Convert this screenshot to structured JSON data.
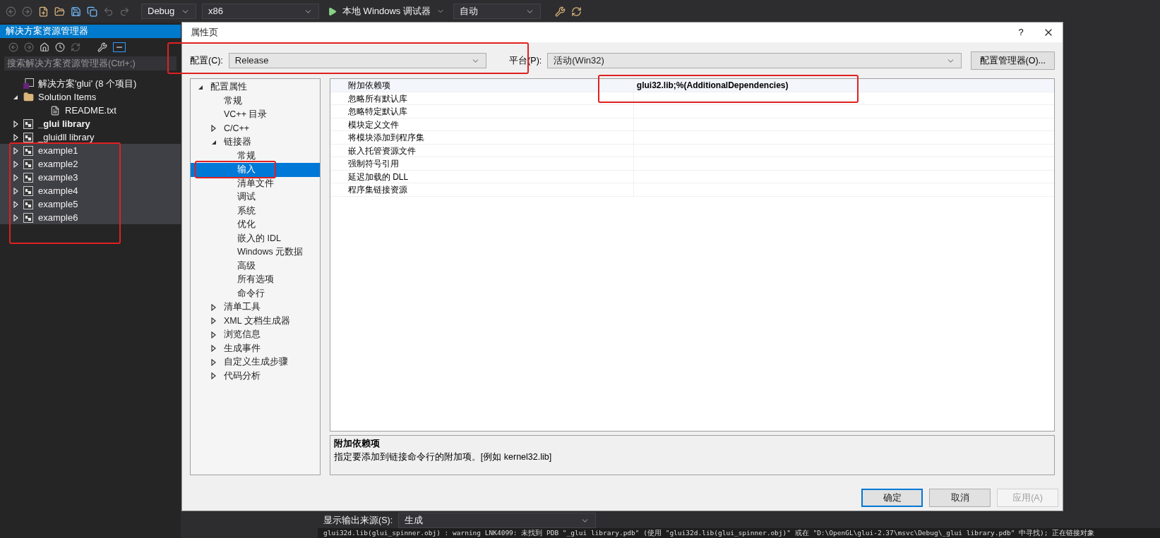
{
  "toolbar": {
    "configuration": "Debug",
    "platform": "x86",
    "debugger": "本地 Windows 调试器",
    "target": "自动"
  },
  "solution_explorer": {
    "title": "解决方案资源管理器",
    "search": {
      "placeholder": "搜索解决方案资源管理器(Ctrl+;)"
    },
    "items": [
      {
        "label": "解决方案'glui' (8 个项目)",
        "kind": "solution",
        "selected": false,
        "startup": false
      },
      {
        "label": "Solution Items",
        "kind": "folder",
        "expanded": true,
        "selected": false,
        "startup": false,
        "children": [
          {
            "label": "README.txt",
            "kind": "file",
            "selected": false,
            "startup": false
          }
        ]
      },
      {
        "label": "_glui library",
        "kind": "project",
        "expanded": false,
        "selected": false,
        "startup": true
      },
      {
        "label": "_gluidll library",
        "kind": "project",
        "expanded": false,
        "selected": false,
        "startup": false
      },
      {
        "label": "example1",
        "kind": "project",
        "expanded": false,
        "selected": true,
        "startup": false
      },
      {
        "label": "example2",
        "kind": "project",
        "expanded": false,
        "selected": true,
        "startup": false
      },
      {
        "label": "example3",
        "kind": "project",
        "expanded": false,
        "selected": true,
        "startup": false
      },
      {
        "label": "example4",
        "kind": "project",
        "expanded": false,
        "selected": true,
        "startup": false
      },
      {
        "label": "example5",
        "kind": "project",
        "expanded": false,
        "selected": true,
        "startup": false
      },
      {
        "label": "example6",
        "kind": "project",
        "expanded": false,
        "selected": true,
        "startup": false
      }
    ]
  },
  "dialog": {
    "title": "属性页",
    "help": "?",
    "config_label": "配置(C):",
    "config": "Release",
    "platform_label": "平台(P):",
    "platform": "活动(Win32)",
    "manager_button": "配置管理器(O)...",
    "tree": [
      {
        "label": "配置属性",
        "expanded": true,
        "selected": false,
        "children": [
          {
            "label": "常规",
            "selected": false
          },
          {
            "label": "VC++ 目录",
            "selected": false
          },
          {
            "label": "C/C++",
            "expanded": false,
            "selected": false
          },
          {
            "label": "链接器",
            "expanded": true,
            "selected": false,
            "children": [
              {
                "label": "常规",
                "selected": false
              },
              {
                "label": "输入",
                "selected": true
              },
              {
                "label": "清单文件",
                "selected": false
              },
              {
                "label": "调试",
                "selected": false
              },
              {
                "label": "系统",
                "selected": false
              },
              {
                "label": "优化",
                "selected": false
              },
              {
                "label": "嵌入的 IDL",
                "selected": false
              },
              {
                "label": "Windows 元数据",
                "selected": false
              },
              {
                "label": "高级",
                "selected": false
              },
              {
                "label": "所有选项",
                "selected": false
              },
              {
                "label": "命令行",
                "selected": false
              }
            ]
          },
          {
            "label": "清单工具",
            "expanded": false,
            "selected": false
          },
          {
            "label": "XML 文档生成器",
            "expanded": false,
            "selected": false
          },
          {
            "label": "浏览信息",
            "expanded": false,
            "selected": false
          },
          {
            "label": "生成事件",
            "expanded": false,
            "selected": false
          },
          {
            "label": "自定义生成步骤",
            "expanded": false,
            "selected": false
          },
          {
            "label": "代码分析",
            "expanded": false,
            "selected": false
          }
        ]
      }
    ],
    "properties": [
      {
        "name": "附加依赖项",
        "value": "glui32.lib;%(AdditionalDependencies)",
        "selected": true
      },
      {
        "name": "忽略所有默认库",
        "selected": false
      },
      {
        "name": "忽略特定默认库",
        "selected": false
      },
      {
        "name": "模块定义文件",
        "selected": false
      },
      {
        "name": "将模块添加到程序集",
        "selected": false
      },
      {
        "name": "嵌入托管资源文件",
        "selected": false
      },
      {
        "name": "强制符号引用",
        "selected": false
      },
      {
        "name": "延迟加载的 DLL",
        "selected": false
      },
      {
        "name": "程序集链接资源",
        "selected": false
      }
    ],
    "description": {
      "title": "附加依赖项",
      "text": "指定要添加到链接命令行的附加项。[例如 kernel32.lib]"
    },
    "buttons": [
      {
        "label": "确定",
        "disabled": false,
        "default": true
      },
      {
        "label": "取消",
        "disabled": false,
        "default": false
      },
      {
        "label": "应用(A)",
        "disabled": true,
        "default": false
      }
    ]
  },
  "output": {
    "source_label": "显示输出来源(S):",
    "source": "生成",
    "line": "glui32d.lib(glui_spinner.obj) : warning LNK4099: 未找到 PDB \"_glui library.pdb\" (使用 \"glui32d.lib(glui_spinner.obj)\" 或在 \"D:\\OpenGL\\glui-2.37\\msvc\\Debug\\_glui library.pdb\" 中寻找); 正在链接对象"
  }
}
